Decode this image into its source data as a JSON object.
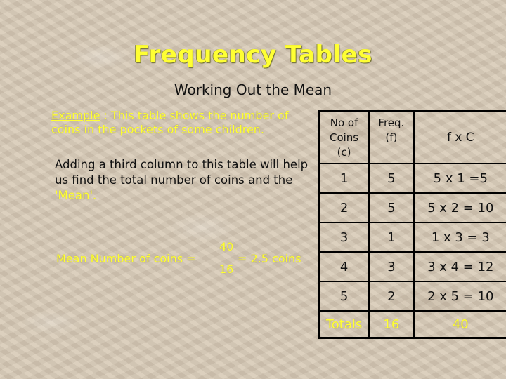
{
  "slide": {
    "title": "Frequency Tables",
    "subtitle": "Working Out the Mean",
    "example": {
      "keyword": "Example",
      "text": " : This table shows the number of coins in the pockets of some children."
    },
    "explanation": {
      "text": "Adding a third column to this table will help us find the total number of coins and the ",
      "highlight": "'Mean'",
      "suffix": "."
    },
    "mean_formula": {
      "label": "Mean Number of coins =",
      "numerator": "40",
      "denominator": "16",
      "result": "= 2.5 coins"
    }
  },
  "table": {
    "headers": [
      "No of Coins (c)",
      "Freq. (f)",
      "f x C"
    ],
    "header_lines": [
      [
        "No of",
        "Coins",
        "(c)"
      ],
      [
        "Freq.",
        "(f)"
      ],
      [
        "f x C"
      ]
    ],
    "rows": [
      [
        "1",
        "5",
        "5 x 1 =5"
      ],
      [
        "2",
        "5",
        "5 x 2 = 10"
      ],
      [
        "3",
        "1",
        "1 x 3 = 3"
      ],
      [
        "4",
        "3",
        "3 x 4 = 12"
      ],
      [
        "5",
        "2",
        "2 x 5 = 10"
      ]
    ],
    "totals": [
      "Totals",
      "16",
      "40"
    ]
  },
  "colors": {
    "highlight_yellow": "#ffff33",
    "text_dark": "#111111",
    "background": "#d8cab6"
  }
}
